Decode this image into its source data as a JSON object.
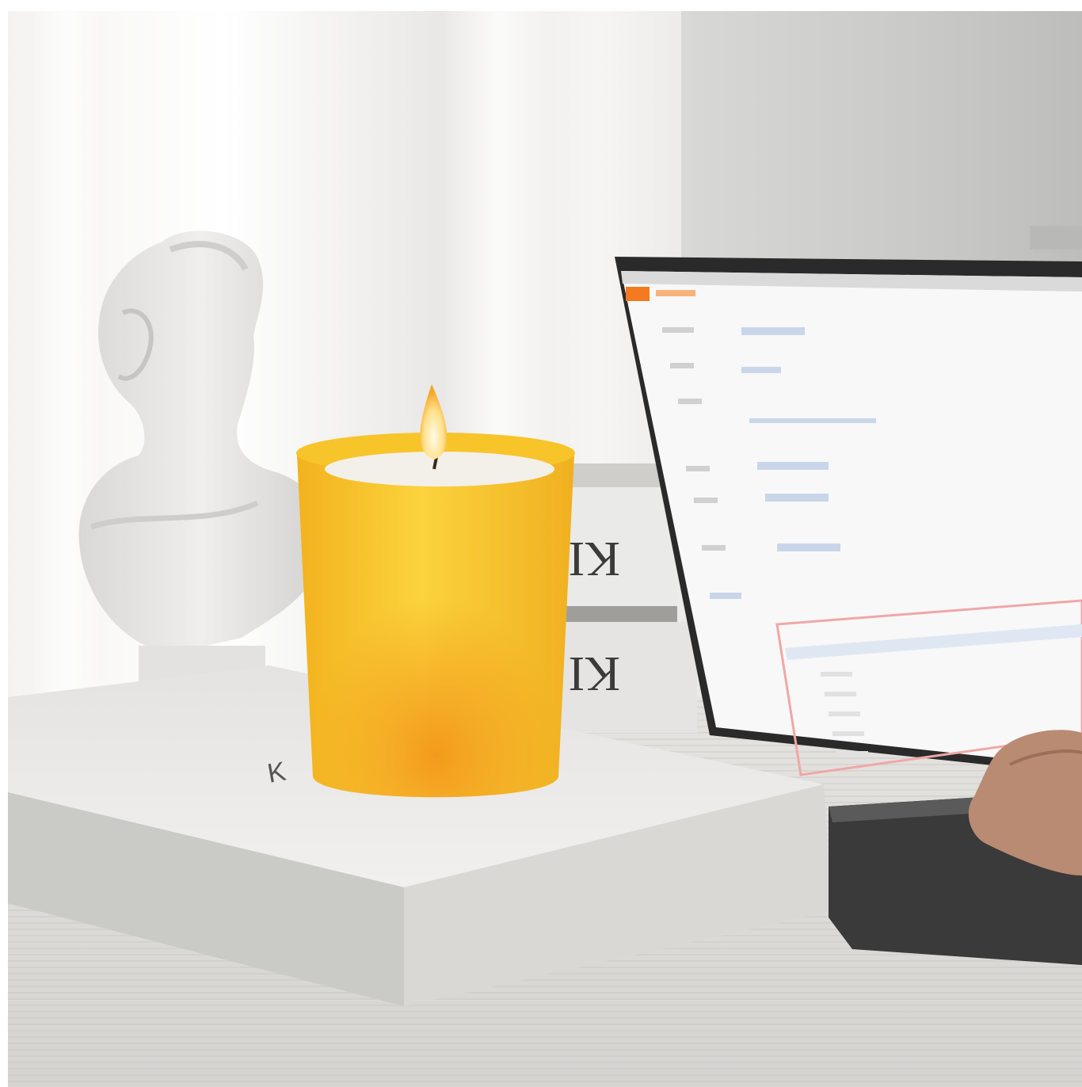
{
  "scene": {
    "description_label": "",
    "colors": {
      "candle_jar": "#f7c42a",
      "candle_glow": "#f39a1c",
      "wax": "#f3f0e9",
      "flame": "#fff3c4",
      "laptop_accent": "#f37a1f",
      "book": "#efefed",
      "table": "#e2e1de",
      "bust": "#e7e6e4"
    }
  },
  "book_spines": {
    "upper": "KI",
    "lower": "KI"
  },
  "book_cover_mark": "K",
  "laptop_screen": {
    "accent_color": "#f37a1f"
  }
}
